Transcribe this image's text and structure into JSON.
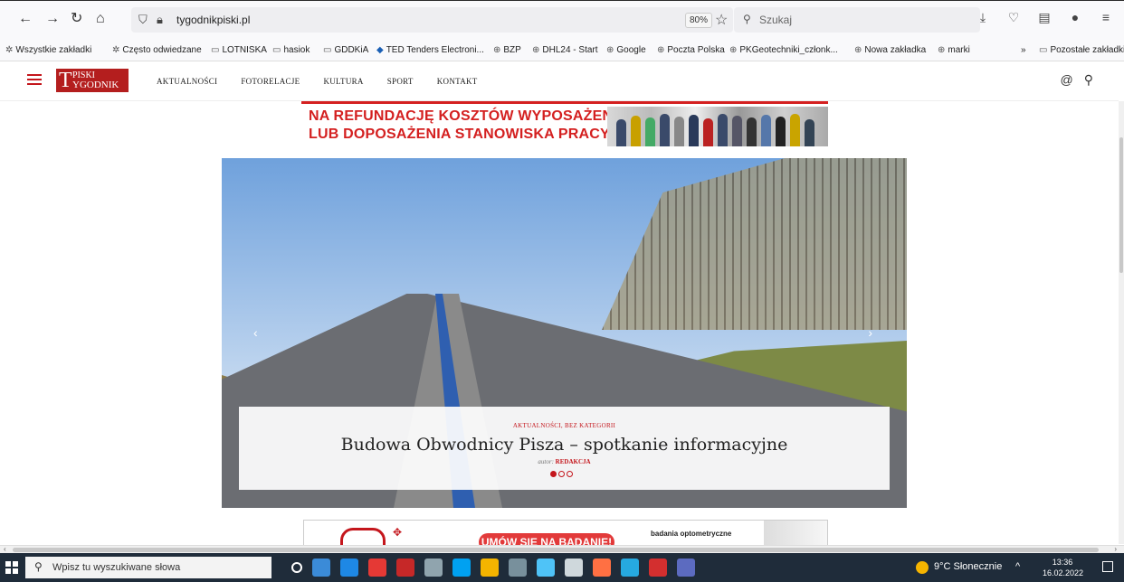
{
  "browser": {
    "url": "tygodnikpiski.pl",
    "zoom": "80%",
    "search_placeholder": "Szukaj",
    "bookmarks": [
      "Wszystkie zakładki",
      "Często odwiedzane",
      "LOTNISKA",
      "hasiok",
      "GDDKiA",
      "TED Tenders Electroni...",
      "BZP",
      "DHL24 - Start",
      "Google",
      "Poczta Polska",
      "PKGeotechniki_członk...",
      "Nowa zakładka",
      "marki"
    ],
    "other_bookmarks": "Pozostałe zakładki",
    "overflow": "»"
  },
  "site": {
    "logo_line1": "PISKI",
    "logo_line2": "YGODNIK",
    "logo_big": "T",
    "menu": [
      "AKTUALNOŚCI",
      "FOTORELACJE",
      "KULTURA",
      "SPORT",
      "KONTAKT"
    ]
  },
  "ad_top": {
    "line1": "NA REFUNDACJĘ KOSZTÓW WYPOSAŻENIA",
    "line2": "LUB DOPOSAŻENIA STANOWISKA PRACY"
  },
  "slider": {
    "category": "AKTUALNOŚCI, BEZ KATEGORII",
    "title": "Budowa Obwodnicy Pisza – spotkanie informacyjne",
    "author_label": "autor:",
    "author": "REDAKCJA",
    "slide_count": 3,
    "active_slide": 1
  },
  "ad_bottom": {
    "button": "UMÓW SIĘ NA BADANIE!",
    "text": "badania optometryczne"
  },
  "taskbar": {
    "search_placeholder": "Wpisz tu wyszukiwane słowa",
    "weather": "9°C Słonecznie",
    "time": "13:36",
    "date": "16.02.2022",
    "app_colors": [
      "#ffffff",
      "#3b8bd8",
      "#1e88e5",
      "#e53935",
      "#c62828",
      "#90a4ae",
      "#00a1f1",
      "#f4b400",
      "#78909c",
      "#4fc3f7",
      "#cfd8dc",
      "#ff7043",
      "#26a9e0",
      "#d32f2f",
      "#5c6bc0"
    ]
  }
}
